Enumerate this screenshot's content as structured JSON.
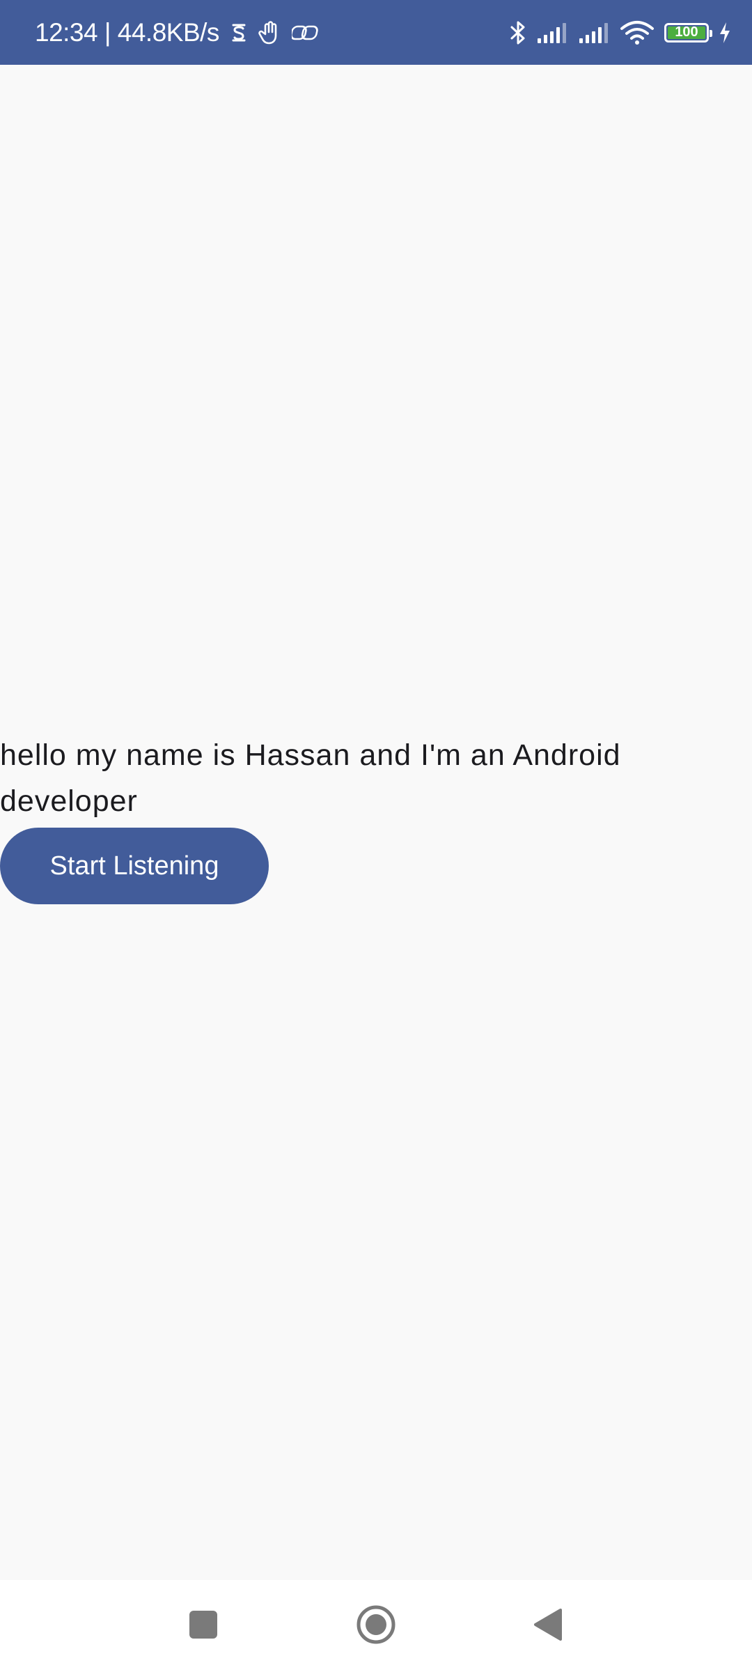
{
  "status_bar": {
    "time_speed": "12:34 | 44.8KB/s",
    "battery_level": "100",
    "background_color": "#425c9a",
    "battery_fill_color": "#4cae3f",
    "left_icons": [
      "notification-s-icon",
      "hand-icon",
      "linked-rings-icon"
    ],
    "right_icons": [
      "bluetooth-icon",
      "signal-icon",
      "signal-icon",
      "wifi-icon",
      "battery-icon",
      "charging-icon"
    ]
  },
  "main": {
    "transcript": "hello my name is Hassan and I'm an Android developer",
    "start_button_label": "Start Listening",
    "accent_color": "#425c9a"
  },
  "nav_bar": {
    "buttons": [
      "recents-square-icon",
      "home-circle-icon",
      "back-triangle-icon"
    ]
  }
}
